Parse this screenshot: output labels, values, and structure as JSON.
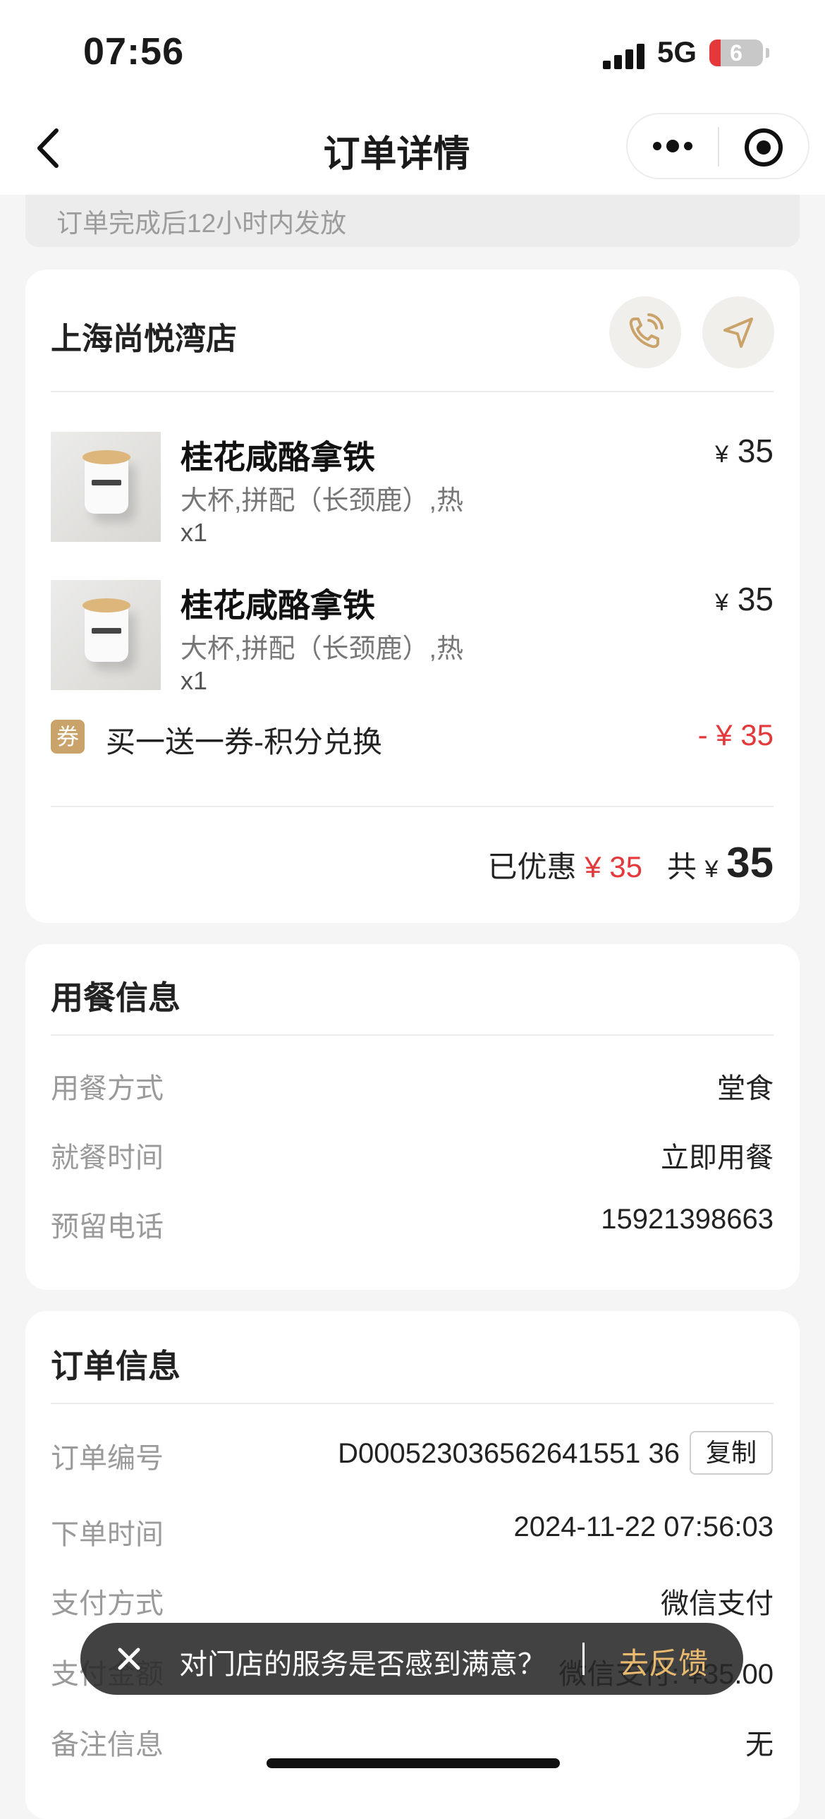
{
  "status_bar": {
    "time": "07:56",
    "network": "5G",
    "battery": "6"
  },
  "nav": {
    "title": "订单详情"
  },
  "notice": "订单完成后12小时内发放",
  "store": {
    "name": "上海尚悦湾店"
  },
  "items": [
    {
      "name": "桂花咸酪拿铁",
      "spec": "大杯,拼配（长颈鹿）,热",
      "qty": "x1",
      "currency": "¥",
      "price": "35"
    },
    {
      "name": "桂花咸酪拿铁",
      "spec": "大杯,拼配（长颈鹿）,热",
      "qty": "x1",
      "currency": "¥",
      "price": "35"
    }
  ],
  "coupon": {
    "badge": "券",
    "name": "买一送一券-积分兑换",
    "amount": "- ¥ 35"
  },
  "summary": {
    "discount_label": "已优惠",
    "discount_value": "¥ 35",
    "total_label": "共",
    "currency": "¥",
    "total_value": "35"
  },
  "dining": {
    "title": "用餐信息",
    "rows": [
      {
        "label": "用餐方式",
        "value": "堂食"
      },
      {
        "label": "就餐时间",
        "value": "立即用餐"
      },
      {
        "label": "预留电话",
        "value": "15921398663"
      }
    ]
  },
  "order": {
    "title": "订单信息",
    "order_no_label": "订单编号",
    "order_no": "D000523036562641551 36",
    "copy_label": "复制",
    "rows": [
      {
        "label": "下单时间",
        "value": "2024-11-22 07:56:03"
      },
      {
        "label": "支付方式",
        "value": "微信支付"
      },
      {
        "label": "支付金额",
        "value": "微信支付: ¥35.00"
      },
      {
        "label": "备注信息",
        "value": "无"
      }
    ]
  },
  "toast": {
    "text": "对门店的服务是否感到满意？",
    "action": "去反馈"
  },
  "colors": {
    "accent": "#c9a36a",
    "discount_red": "#e5383b",
    "toast_action": "#e8b96f"
  }
}
